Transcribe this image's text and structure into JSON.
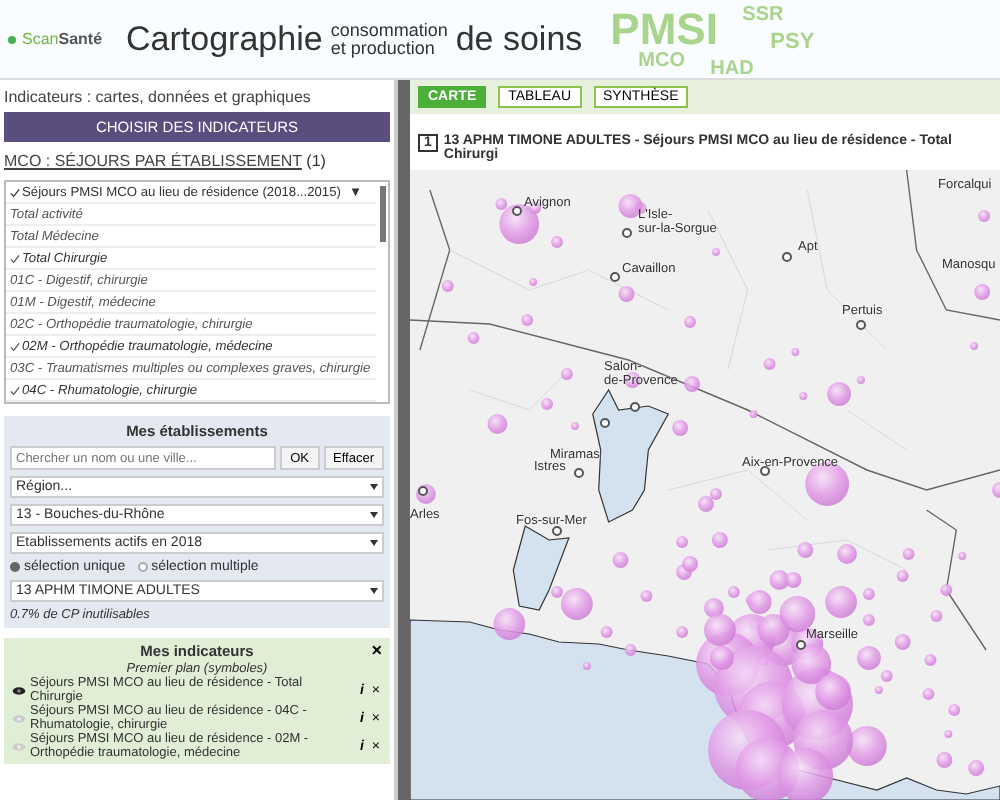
{
  "header": {
    "logo_part1": "Scan",
    "logo_part2": "Santé",
    "title_main": "Cartographie",
    "title_sup": "consommation",
    "title_sub": "et production",
    "title_end": "de soins",
    "badges": [
      "PMSI",
      "SSR",
      "PSY",
      "MCO",
      "HAD"
    ]
  },
  "left": {
    "heading": "Indicateurs : cartes, données et graphiques",
    "choose_button": "CHOISIR DES INDICATEURS",
    "section_link": "MCO : SÉJOURS PAR ÉTABLISSEMENT",
    "section_count": "(1)",
    "indicator_group": {
      "label": "Séjours PMSI MCO au lieu de résidence (2018...2015)",
      "caret": "▼",
      "checked": true
    },
    "indicators": [
      {
        "label": "Total activité",
        "checked": false
      },
      {
        "label": "Total Médecine",
        "checked": false
      },
      {
        "label": "Total Chirurgie",
        "checked": true
      },
      {
        "label": "01C - Digestif, chirurgie",
        "checked": false
      },
      {
        "label": "01M - Digestif, médecine",
        "checked": false
      },
      {
        "label": "02C - Orthopédie traumatologie, chirurgie",
        "checked": false
      },
      {
        "label": "02M - Orthopédie traumatologie, médecine",
        "checked": true
      },
      {
        "label": "03C - Traumatismes multiples ou complexes graves, chirurgie",
        "checked": false
      },
      {
        "label": "04C - Rhumatologie, chirurgie",
        "checked": true
      }
    ],
    "establishments": {
      "title": "Mes établissements",
      "search_placeholder": "Chercher un nom ou une ville...",
      "ok_button": "OK",
      "clear_button": "Effacer",
      "selects": [
        "Région...",
        "13 - Bouches-du-Rhône",
        "Etablissements actifs en 2018"
      ],
      "modes": [
        {
          "label": "sélection unique",
          "selected": true
        },
        {
          "label": "sélection multiple",
          "selected": false
        }
      ],
      "establishment": "13 APHM TIMONE ADULTES",
      "note": "0.7% de CP inutilisables"
    },
    "my_indicators": {
      "title": "Mes indicateurs",
      "close": "×",
      "layer_title": "Premier plan (symboles)",
      "layers": [
        {
          "label": "Séjours PMSI MCO au lieu de résidence - Total Chirurgie",
          "visible": true
        },
        {
          "label": "Séjours PMSI MCO au lieu de résidence - 04C - Rhumatologie, chirurgie",
          "visible": false
        },
        {
          "label": "Séjours PMSI MCO au lieu de résidence - 02M - Orthopédie traumatologie, médecine",
          "visible": false
        }
      ],
      "info_icons": [
        "i",
        "i",
        "i"
      ],
      "remove_icons": [
        "×",
        "×",
        "×"
      ]
    }
  },
  "tabs": [
    {
      "label": "CARTE",
      "selected": true
    },
    {
      "label": "TABLEAU",
      "selected": false
    },
    {
      "label": "SYNTHÈSE",
      "selected": false
    }
  ],
  "map": {
    "number": "1",
    "title": "13 APHM TIMONE ADULTES - Séjours PMSI MCO au lieu de résidence - Total Chirurgi",
    "cities": [
      "Avignon",
      "L'Isle-\nsur-la-Sorgue",
      "Apt",
      "Cavaillon",
      "Forcalqui",
      "Manosqu",
      "Pertuis",
      "Salon-\nde-Provence",
      "Miramas",
      "Istres",
      "Arles",
      "Fos-sur-Mer",
      "Aix-en-Provence",
      "Marseille"
    ]
  }
}
